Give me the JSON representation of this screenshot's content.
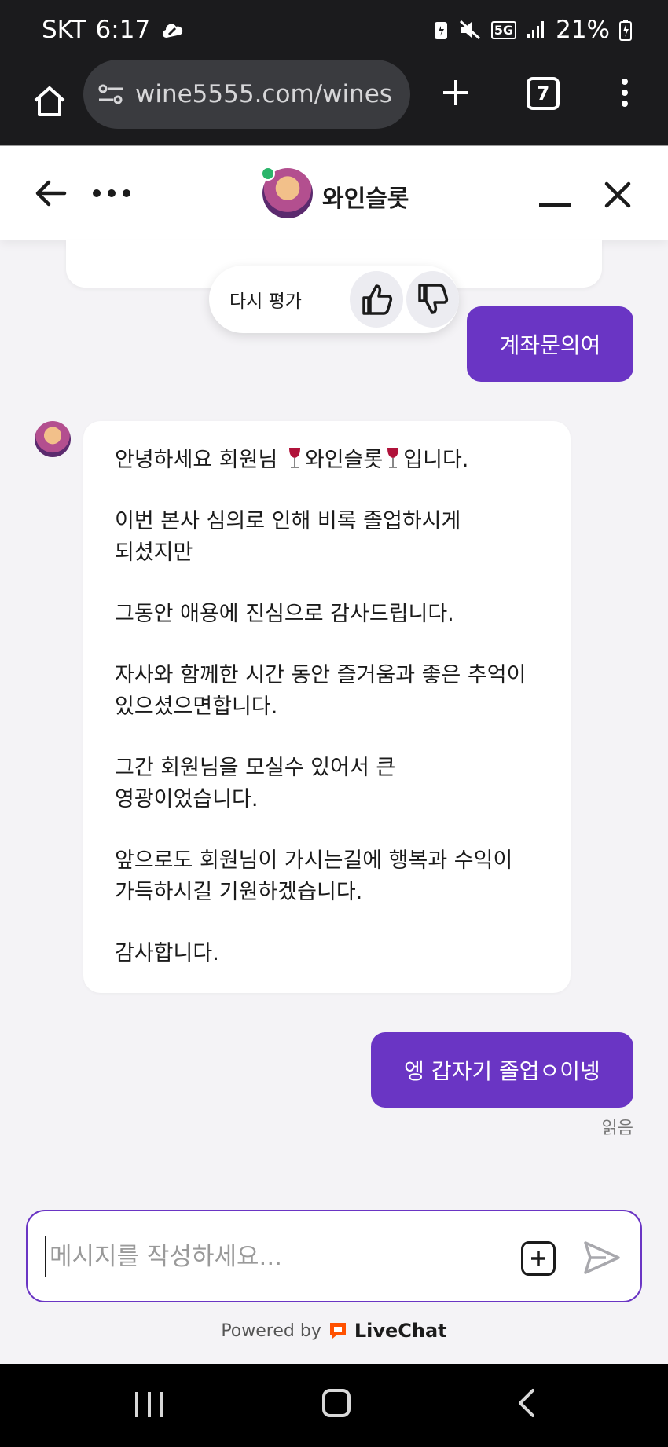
{
  "status_bar": {
    "carrier": "SKT",
    "time": "6:17",
    "network": "5G",
    "battery": "21%"
  },
  "browser": {
    "url": "wine5555.com/wines",
    "tab_count": "7"
  },
  "chat_header": {
    "agent_name": "와인슬롯",
    "online_color": "#2bb56a"
  },
  "rating": {
    "label": "다시 평가",
    "thumbs_up_icon": "thumbs-up-icon",
    "thumbs_down_icon": "thumbs-down-icon"
  },
  "messages": {
    "user_1": "계좌문의여",
    "agent_lines": [
      "안녕하세요 회원님 ",
      "와인슬롯",
      "입니다.",
      "이번 본사 심의로 인해 비록 졸업하시게 되셨지만",
      "그동안 애용에 진심으로 감사드립니다.",
      "자사와 함께한 시간 동안 즐거움과 좋은 추억이 있으셨으면합니다.",
      "그간 회원님을 모실수 있어서 큰 영광이었습니다.",
      "앞으로도 회원님이 가시는길에 행복과 수익이 가득하시길 기원하겠습니다.",
      "감사합니다."
    ],
    "user_2": "엥 갑자기 졸업ㅇ이넹",
    "read_receipt": "읽음"
  },
  "composer": {
    "placeholder": "메시지를 작성하세요..."
  },
  "footer": {
    "powered_by": "Powered by",
    "brand": "LiveChat"
  },
  "colors": {
    "accent": "#6a35c4",
    "background": "#f4f3f6",
    "livechat_orange": "#ff5100"
  }
}
